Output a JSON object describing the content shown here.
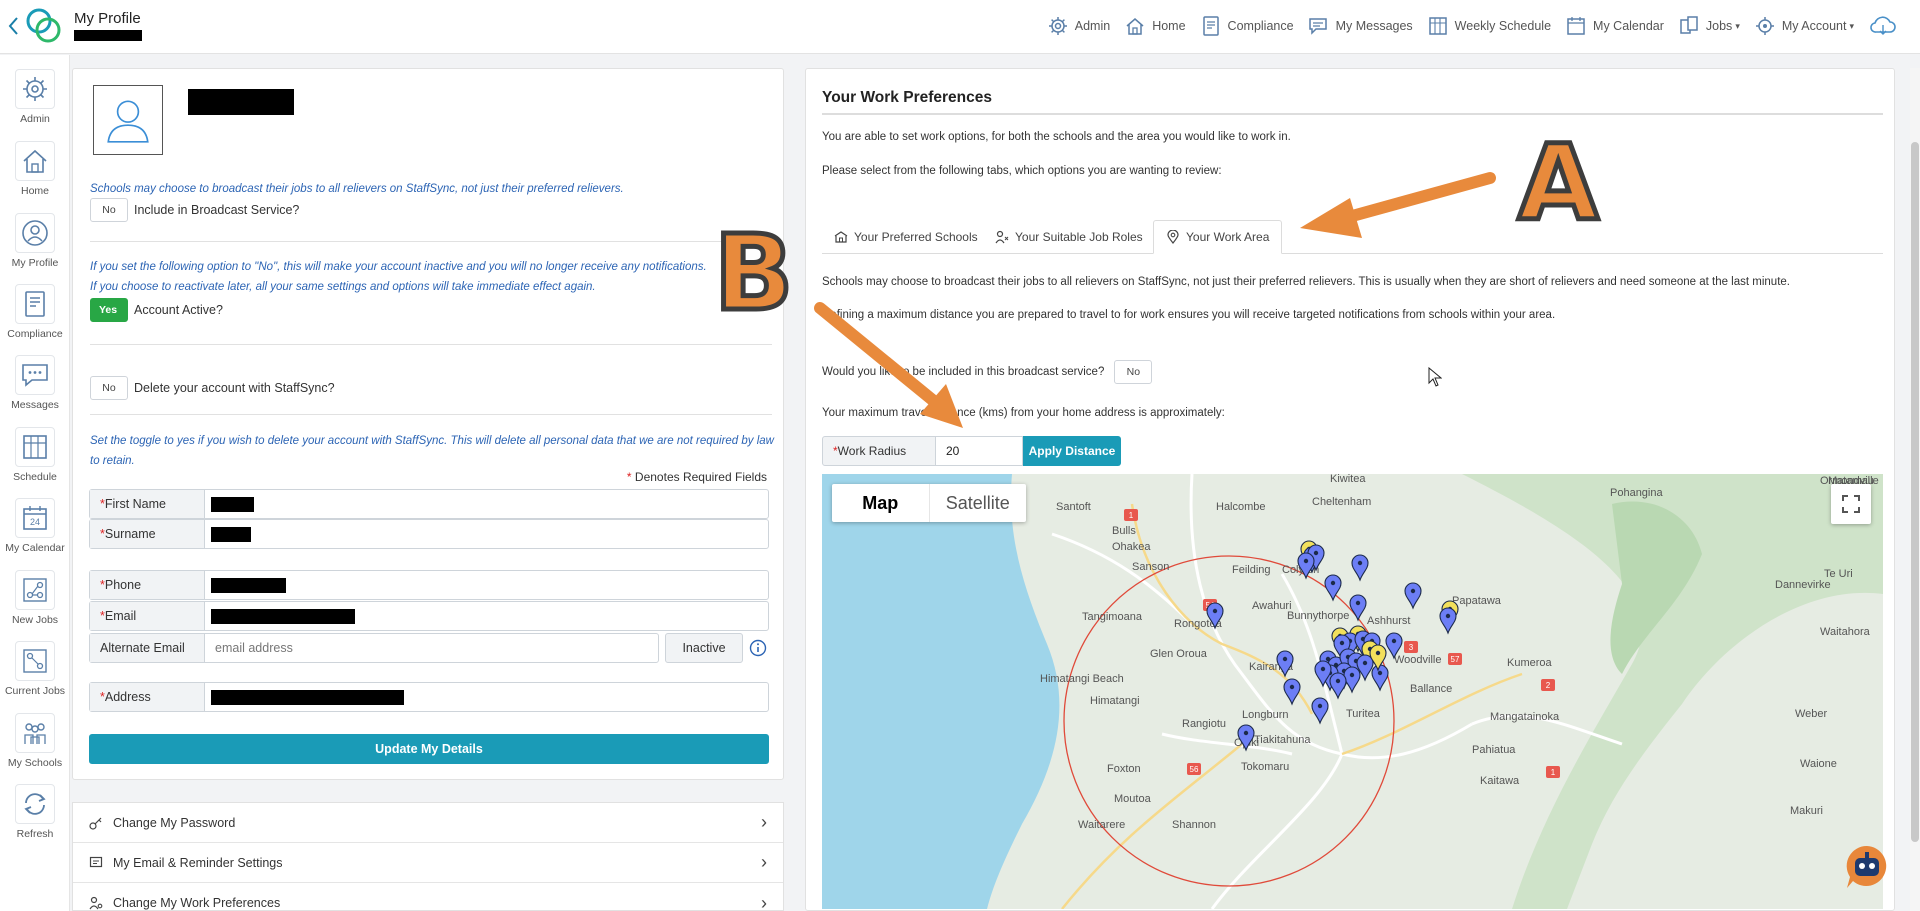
{
  "topbar": {
    "title": "My Profile",
    "nav": [
      {
        "label": "Admin",
        "icon": "admin-icon"
      },
      {
        "label": "Home",
        "icon": "home-icon"
      },
      {
        "label": "Compliance",
        "icon": "compliance-icon"
      },
      {
        "label": "My Messages",
        "icon": "messages-icon"
      },
      {
        "label": "Weekly Schedule",
        "icon": "schedule-icon"
      },
      {
        "label": "My Calendar",
        "icon": "calendar-icon"
      },
      {
        "label": "Jobs",
        "icon": "jobs-icon"
      },
      {
        "label": "My Account",
        "icon": "account-icon"
      }
    ]
  },
  "rail": [
    {
      "label": "Admin"
    },
    {
      "label": "Home"
    },
    {
      "label": "My Profile"
    },
    {
      "label": "Compliance"
    },
    {
      "label": "Messages"
    },
    {
      "label": "Schedule"
    },
    {
      "label": "My Calendar",
      "badge": "24"
    },
    {
      "label": "New Jobs"
    },
    {
      "label": "Current Jobs"
    },
    {
      "label": "My Schools"
    },
    {
      "label": "Refresh"
    }
  ],
  "profile": {
    "broadcast_note": "Schools may choose to broadcast their jobs to all relievers on StaffSync, not just their preferred relievers.",
    "broadcast_toggle": "No",
    "broadcast_label": "Include in Broadcast Service?",
    "inactive_note_1": "If you set the following option to \"No\", this will make your account inactive and you will no longer receive any notifications.",
    "inactive_note_2": "If you choose to reactivate later, all your same settings and options will take immediate effect again.",
    "active_toggle": "Yes",
    "active_label": "Account Active?",
    "delete_toggle": "No",
    "delete_label": "Delete your account with StaffSync?",
    "delete_note": "Set the toggle to yes if you wish to delete your account with StaffSync. This will delete all personal data that we are not required by law to retain.",
    "required_note": "Denotes Required Fields",
    "required_star": "*",
    "fields": {
      "first_name": "First Name",
      "surname": "Surname",
      "phone": "Phone",
      "email": "Email",
      "alternate_email": "Alternate Email",
      "alternate_placeholder": "email address",
      "address": "Address"
    },
    "inactive_button": "Inactive",
    "update_button": "Update My Details"
  },
  "accordion": [
    {
      "label": "Change My Password"
    },
    {
      "label": "My Email & Reminder Settings"
    },
    {
      "label": "Change My Work Preferences"
    }
  ],
  "work": {
    "title": "Your Work Preferences",
    "intro_1": "You are able to set work options, for both the schools and the area you would like to work in.",
    "intro_2": "Please select from the following tabs, which options you are wanting to review:",
    "tabs": [
      {
        "label": "Your Preferred Schools",
        "active": false
      },
      {
        "label": "Your Suitable Job Roles",
        "active": false
      },
      {
        "label": "Your Work Area",
        "active": true
      }
    ],
    "para_1": "Schools may choose to broadcast their jobs to all relievers on StaffSync, not just their preferred relievers. This is usually when they are short of relievers and need someone at the last minute.",
    "para_2": "Defining a maximum distance you are prepared to travel to for work ensures you will receive targeted notifications from schools within your area.",
    "broadcast_question": "Would you like to be included in this broadcast service?",
    "broadcast_toggle": "No",
    "distance_label": "Your maximum travel distance (kms) from your home address is approximately:",
    "radius_label": "Work Radius",
    "radius_value": "20",
    "apply_button": "Apply Distance"
  },
  "map": {
    "map_button": "Map",
    "satellite_button": "Satellite",
    "places": [
      "Kiwitea",
      "Pohangina",
      "Matamau",
      "Ormondville",
      "Santoft",
      "Halcombe",
      "Cheltenham",
      "Bulls",
      "Ohakea",
      "Feilding",
      "Colyton",
      "Sanson",
      "Dannevirke",
      "Te Uri",
      "Awahuri",
      "Bunnythorpe",
      "Ashhurst",
      "Papatawa",
      "Tangimoana",
      "Rongotea",
      "Glen Oroua",
      "Waitahora",
      "Woodville",
      "Kumeroa",
      "Kairanga",
      "Himatangi Beach",
      "Himatangi",
      "Longburn",
      "Ballance",
      "Weber",
      "Tiakitahuna",
      "Turitea",
      "Mangatainoka",
      "Rangiotu",
      "Opiki",
      "Pahiatua",
      "Waione",
      "Foxton",
      "Tokomaru",
      "Kaitawa",
      "Moutoa",
      "Makuri",
      "Waitarere",
      "Shannon"
    ],
    "road_labels": [
      "1",
      "54",
      "3",
      "57",
      "2",
      "56",
      "1"
    ]
  },
  "annotations": {
    "letter_a": "A",
    "letter_b": "B"
  },
  "colors": {
    "accent": "#1a9bb7",
    "active_green": "#28a745",
    "arrow_orange": "#e88a3c",
    "pin_blue": "#6c7ef5",
    "pin_yellow": "#f2e05c"
  }
}
